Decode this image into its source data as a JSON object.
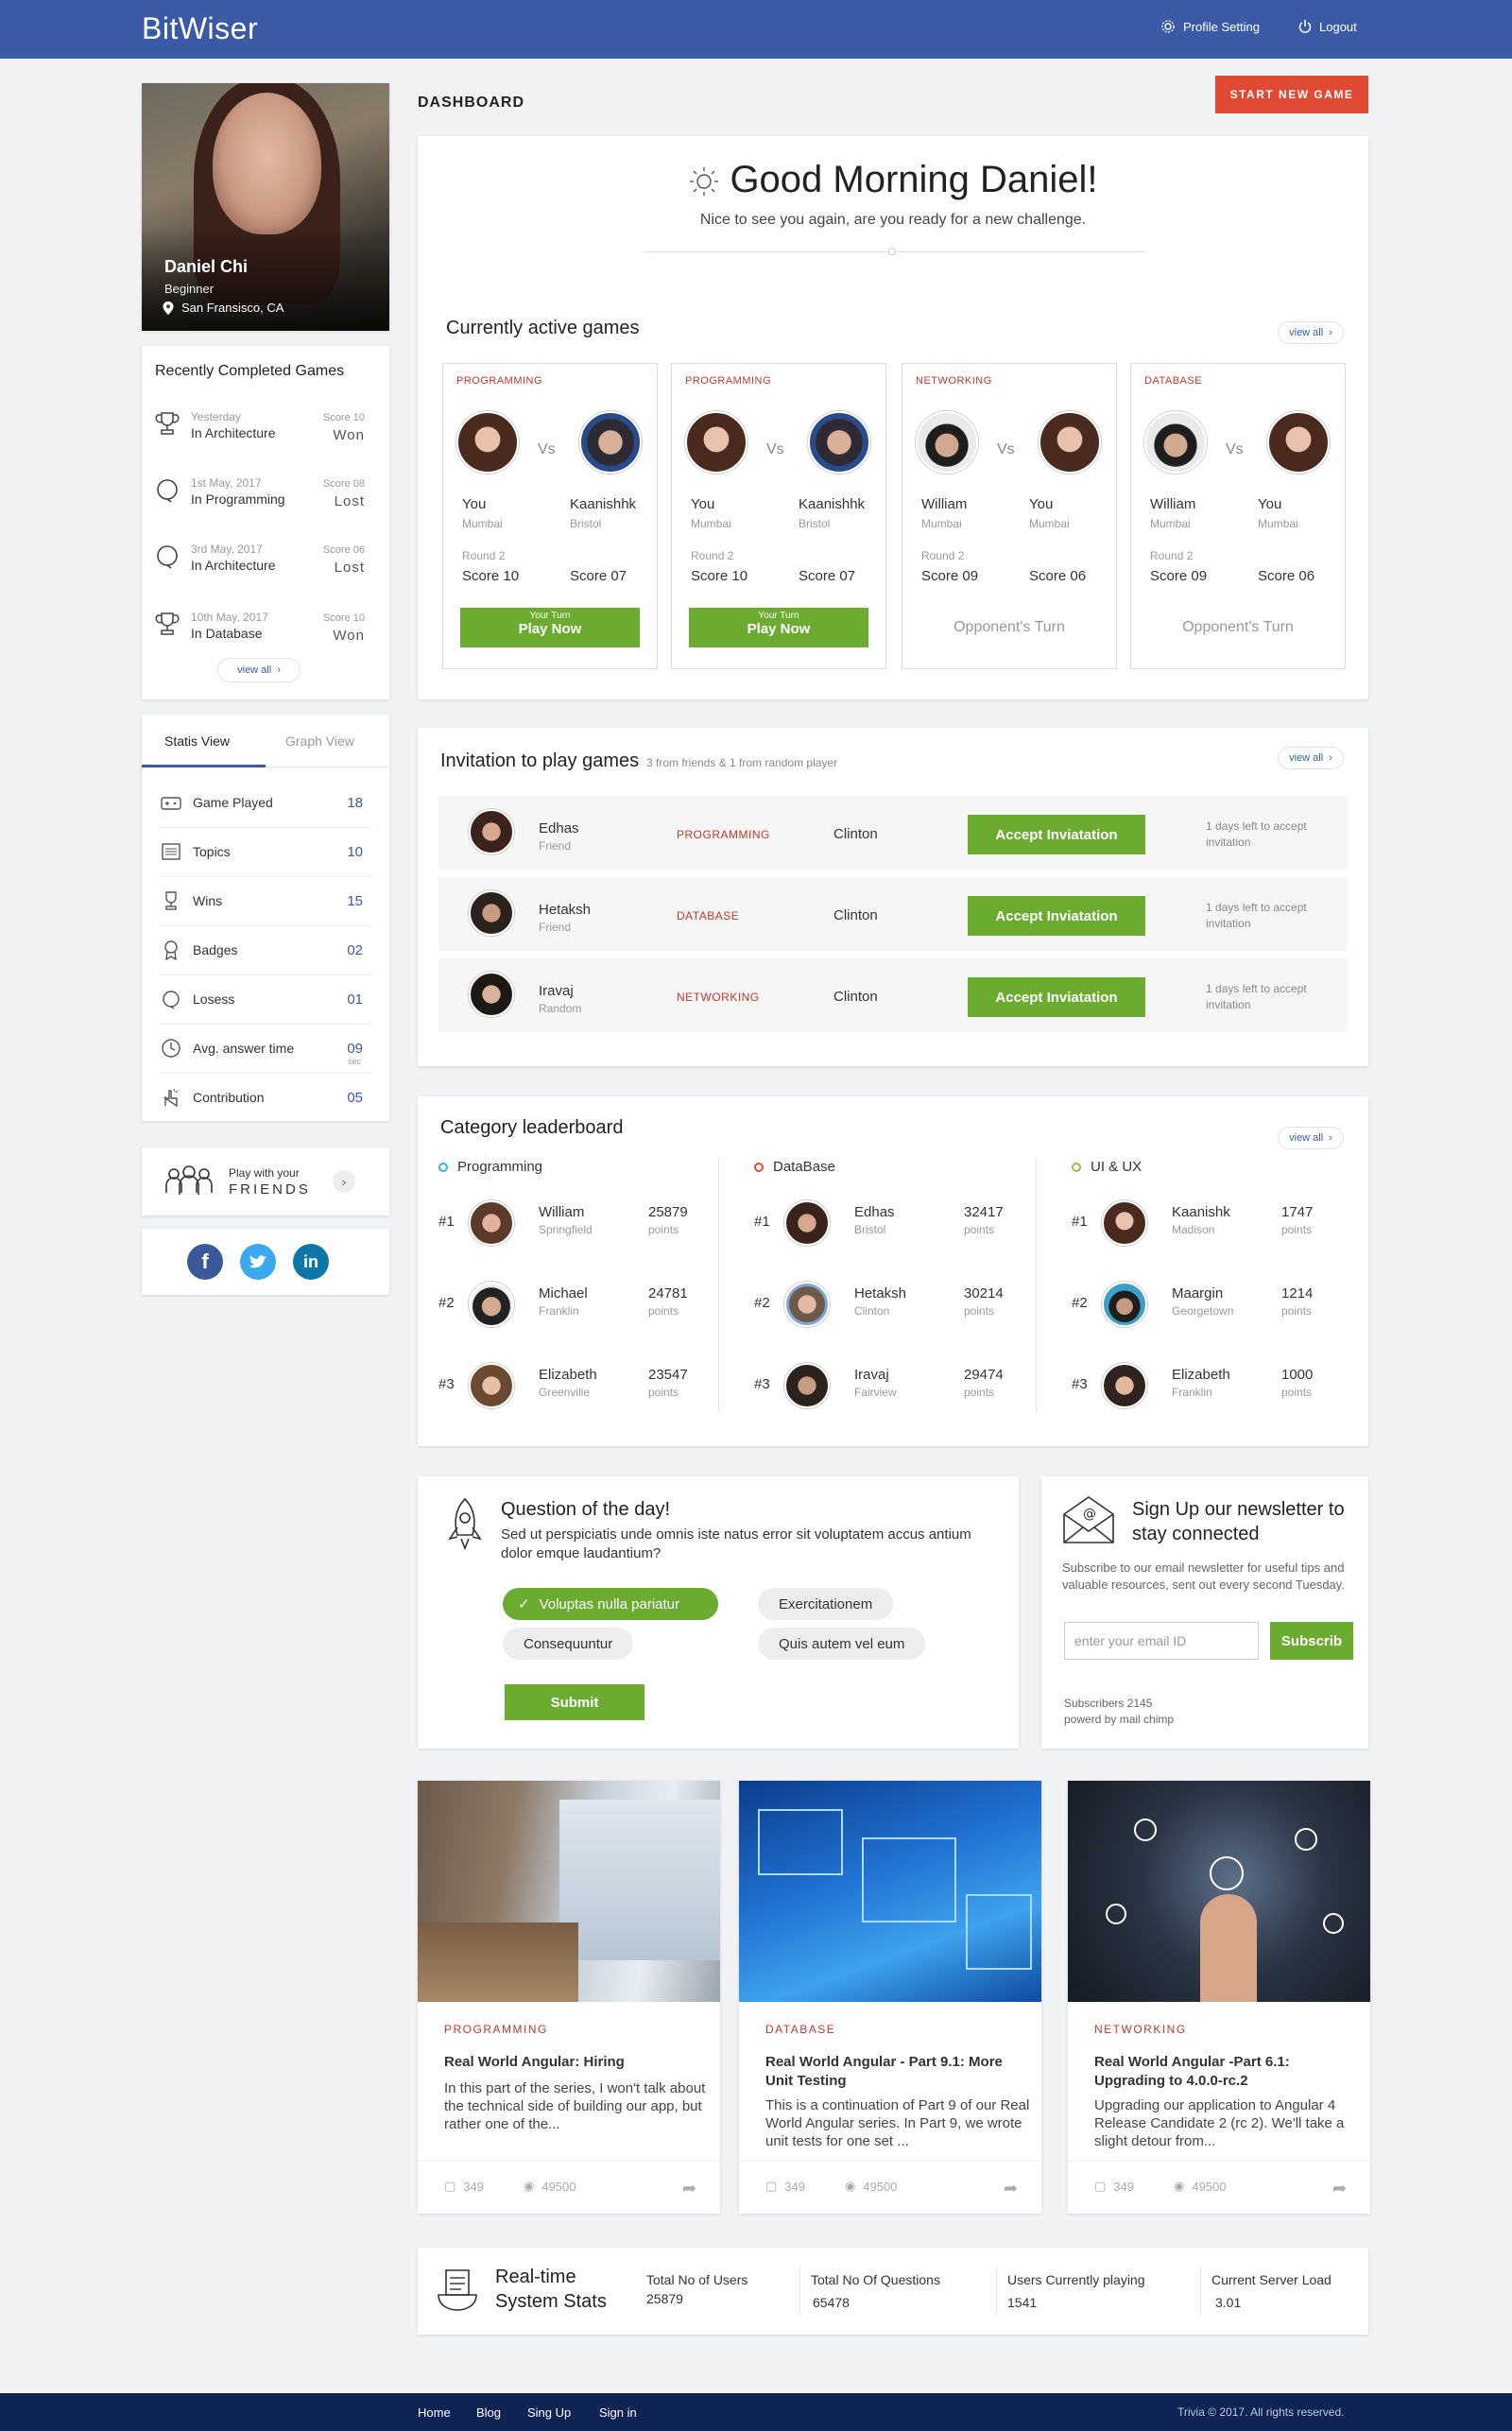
{
  "header": {
    "logo": "BitWiser",
    "profile_setting": "Profile Setting",
    "logout": "Logout"
  },
  "profile": {
    "name": "Daniel Chi",
    "level": "Beginner",
    "location": "San Fransisco, CA"
  },
  "recent": {
    "title": "Recently Completed Games",
    "items": [
      {
        "date": "Yesterday",
        "topic": "In Architecture",
        "score": "Score 10",
        "result": "Won",
        "icon": "trophy-icon"
      },
      {
        "date": "1st May, 2017",
        "topic": "In Programming",
        "score": "Score 08",
        "result": "Lost",
        "icon": "ring-icon"
      },
      {
        "date": "3rd May, 2017",
        "topic": "In Architecture",
        "score": "Score 06",
        "result": "Lost",
        "icon": "ring-icon"
      },
      {
        "date": "10th May, 2017",
        "topic": "In Database",
        "score": "Score 10",
        "result": "Won",
        "icon": "trophy-icon"
      }
    ],
    "view_all": "view all"
  },
  "stats_panel": {
    "tab_statis": "Statis View",
    "tab_graph": "Graph View",
    "rows": [
      {
        "label": "Game Played",
        "value": "18",
        "icon": "controller-icon"
      },
      {
        "label": "Topics",
        "value": "10",
        "icon": "list-icon"
      },
      {
        "label": "Wins",
        "value": "15",
        "icon": "trophy-icon"
      },
      {
        "label": "Badges",
        "value": "02",
        "icon": "badge-icon"
      },
      {
        "label": "Losess",
        "value": "01",
        "icon": "ring-icon"
      },
      {
        "label": "Avg. answer time",
        "value": "09",
        "unit": "sec",
        "icon": "clock-icon"
      },
      {
        "label": "Contribution",
        "value": "05",
        "icon": "hand-icon"
      }
    ]
  },
  "friends": {
    "line1": "Play with your",
    "line2": "FRIENDS"
  },
  "dashboard": {
    "title": "DASHBOARD",
    "start_button": "START NEW GAME"
  },
  "greeting": {
    "title": "Good Morning Daniel!",
    "subtitle": "Nice to see you again, are you ready for a new challenge."
  },
  "active_games": {
    "title": "Currently active games",
    "view_all": "view all",
    "games": [
      {
        "category": "PROGRAMMING",
        "p1": "You",
        "c1": "Mumbai",
        "p2": "Kaanishhk",
        "c2": "Bristol",
        "round": "Round 2",
        "s1": "Score  10",
        "s2": "Score  07",
        "btn_small": "Your Turn",
        "btn_big": "Play Now",
        "status": ""
      },
      {
        "category": "PROGRAMMING",
        "p1": "You",
        "c1": "Mumbai",
        "p2": "Kaanishhk",
        "c2": "Bristol",
        "round": "Round 2",
        "s1": "Score  10",
        "s2": "Score  07",
        "btn_small": "Your Turn",
        "btn_big": "Play Now",
        "status": ""
      },
      {
        "category": "NETWORKING",
        "p1": "William",
        "c1": "Mumbai",
        "p2": "You",
        "c2": "Mumbai",
        "round": "Round 2",
        "s1": "Score  09",
        "s2": "Score  06",
        "btn_small": "",
        "btn_big": "",
        "status": "Opponent's Turn"
      },
      {
        "category": "DATABASE",
        "p1": "William",
        "c1": "Mumbai",
        "p2": "You",
        "c2": "Mumbai",
        "round": "Round 2",
        "s1": "Score  09",
        "s2": "Score  06",
        "btn_small": "",
        "btn_big": "",
        "status": "Opponent's Turn"
      }
    ],
    "vs": "Vs"
  },
  "invitations": {
    "title": "Invitation to play games",
    "subtitle": "3 from friends & 1 from random player",
    "view_all": "view all",
    "items": [
      {
        "name": "Edhas",
        "relation": "Friend",
        "category": "PROGRAMMING",
        "opponent": "Clinton",
        "button": "Accept Inviatation",
        "days": "1 days left to accept invitation"
      },
      {
        "name": "Hetaksh",
        "relation": "Friend",
        "category": "DATABASE",
        "opponent": "Clinton",
        "button": "Accept Inviatation",
        "days": "1 days left to accept invitation"
      },
      {
        "name": "Iravaj",
        "relation": "Random",
        "category": "NETWORKING",
        "opponent": "Clinton",
        "button": "Accept Inviatation",
        "days": "1 days left to accept invitation"
      }
    ]
  },
  "leaderboard": {
    "title": "Category leaderboard",
    "view_all": "view all",
    "columns": [
      {
        "name": "Programming",
        "color": "#2bb5c8",
        "rows": [
          {
            "rank": "#1",
            "name": "William",
            "loc": "Springfield",
            "points": "25879",
            "unit": "points"
          },
          {
            "rank": "#2",
            "name": "Michael",
            "loc": "Franklin",
            "points": "24781",
            "unit": "points"
          },
          {
            "rank": "#3",
            "name": "Elizabeth",
            "loc": "Greenville",
            "points": "23547",
            "unit": "points"
          }
        ]
      },
      {
        "name": "DataBase",
        "color": "#e04a34",
        "rows": [
          {
            "rank": "#1",
            "name": "Edhas",
            "loc": "Bristol",
            "points": "32417",
            "unit": "points"
          },
          {
            "rank": "#2",
            "name": "Hetaksh",
            "loc": "Clinton",
            "points": "30214",
            "unit": "points"
          },
          {
            "rank": "#3",
            "name": "Iravaj",
            "loc": "Fairview",
            "points": "29474",
            "unit": "points"
          }
        ]
      },
      {
        "name": "UI & UX",
        "color": "#8bc34a",
        "rows": [
          {
            "rank": "#1",
            "name": "Kaanishk",
            "loc": "Madison",
            "points": "1747",
            "unit": "points"
          },
          {
            "rank": "#2",
            "name": "Maargin",
            "loc": "Georgetown",
            "points": "1214",
            "unit": "points"
          },
          {
            "rank": "#3",
            "name": "Elizabeth",
            "loc": "Franklin",
            "points": "1000",
            "unit": "points"
          }
        ]
      }
    ]
  },
  "question": {
    "title": "Question of the day!",
    "text": "Sed ut perspiciatis unde omnis iste natus error sit voluptatem accus antium dolor emque laudantium?",
    "options": [
      "Voluptas nulla pariatur",
      "Exercitationem",
      "Consequuntur",
      "Quis autem vel eum"
    ],
    "submit": "Submit"
  },
  "newsletter": {
    "title": "Sign Up  our newsletter to stay connected",
    "text": "Subscribe to our email newsletter for useful tips and valuable resources, sent out every second Tuesday.",
    "placeholder": "enter your email ID",
    "button": "Subscrib",
    "subscribers": "Subscribers 2145",
    "powered": "powerd by mail chimp"
  },
  "blogs": [
    {
      "category": "PROGRAMMING",
      "title": "Real World Angular: Hiring",
      "text": "In this part of the series, I won't talk about the technical side of building our app, but rather one of the...",
      "comments": "349",
      "views": "49500"
    },
    {
      "category": "DATABASE",
      "title": "Real World Angular - Part 9.1: More Unit Testing",
      "text": "This is a continuation of Part 9 of our Real World Angular series. In Part 9, we wrote unit tests for one set ...",
      "comments": "349",
      "views": "49500"
    },
    {
      "category": "NETWORKING",
      "title": "Real World Angular -Part 6.1: Upgrading to 4.0.0-rc.2",
      "text": "Upgrading our application to Angular 4 Release Candidate 2 (rc 2). We'll take a slight detour from...",
      "comments": "349",
      "views": "49500"
    }
  ],
  "system_stats": {
    "title_line1": "Real-time",
    "title_line2": "System Stats",
    "items": [
      {
        "label": "Total No of Users",
        "value": "25879"
      },
      {
        "label": "Total No Of Questions",
        "value": "65478"
      },
      {
        "label": "Users Currently playing",
        "value": "1541"
      },
      {
        "label": "Current Server Load",
        "value": "3.01"
      }
    ]
  },
  "footer": {
    "links": [
      "Home",
      "Blog",
      "Sing Up",
      "Sign in"
    ],
    "copyright": "Trivia © 2017. All rights reserved."
  },
  "colors": {
    "primary": "#3b5aa5",
    "accent": "#e04a34",
    "green": "#6aab30",
    "footer": "#0f2354"
  }
}
